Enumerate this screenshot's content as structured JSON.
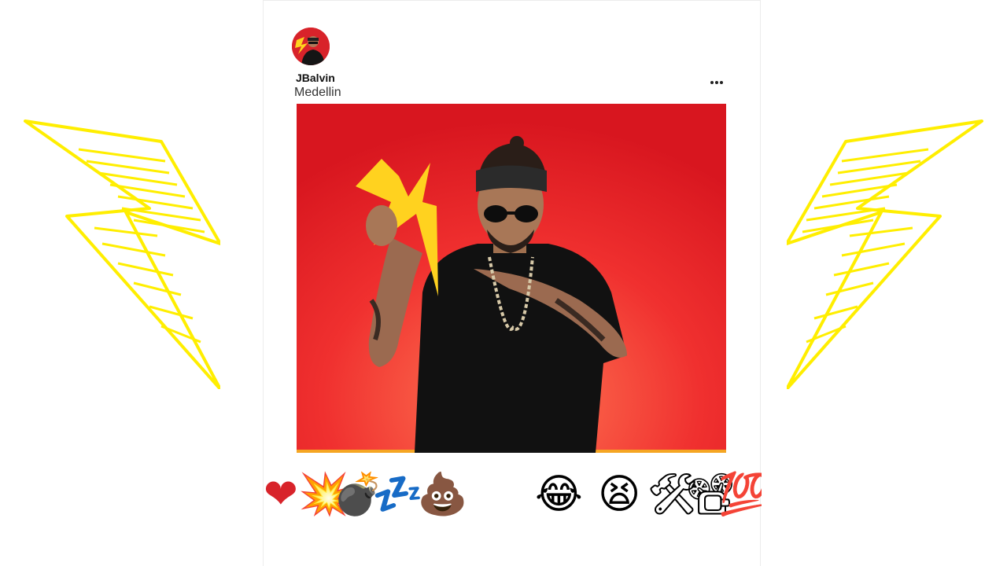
{
  "post": {
    "username": "JBalvin",
    "location": "Medellin",
    "more_icon": "more-horizontal-icon"
  },
  "media": {
    "subject": "man in black t-shirt, bandana and sunglasses holding a yellow lightning bolt",
    "background_color": "#e8232a"
  },
  "decorations": {
    "bolt_color": "#ffee00",
    "icon": "lightning-bolt-icon"
  },
  "emoji_reactions": [
    {
      "name": "heart-emoji",
      "glyph": "❤"
    },
    {
      "name": "collision-emoji",
      "glyph": "💥"
    },
    {
      "name": "bomb-emoji",
      "glyph": "💣"
    },
    {
      "name": "zzz-emoji",
      "glyph": "💤"
    },
    {
      "name": "pile-of-poo-emoji",
      "glyph": "💩"
    },
    {
      "name": "laughing-face-emoji",
      "glyph": "😂"
    },
    {
      "name": "tired-face-emoji",
      "glyph": "😫"
    },
    {
      "name": "hammer-and-wrench-emoji",
      "glyph": "🛠"
    },
    {
      "name": "film-projector-emoji",
      "glyph": "📽"
    },
    {
      "name": "hundred-points-emoji",
      "glyph": "💯"
    }
  ]
}
